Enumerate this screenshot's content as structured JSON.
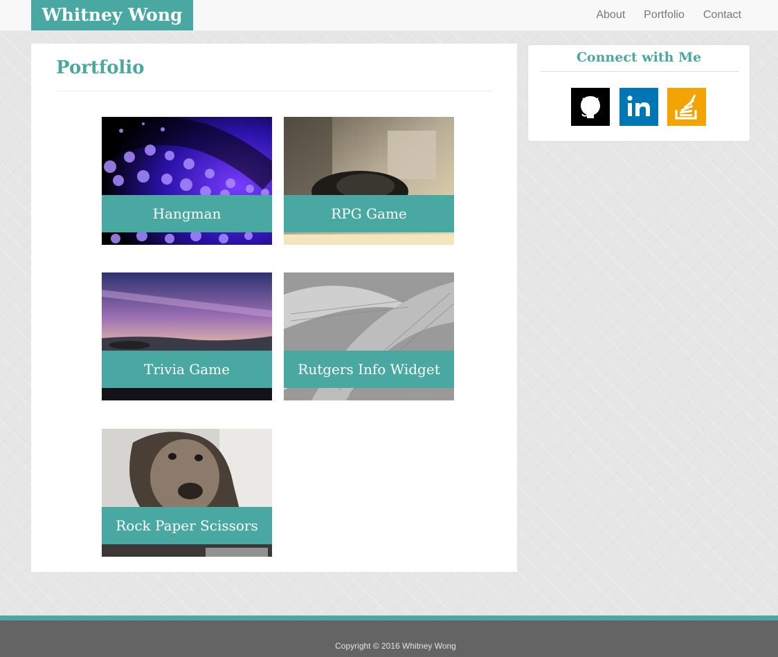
{
  "navbar": {
    "brand": "Whitney Wong",
    "links": [
      {
        "label": "About"
      },
      {
        "label": "Portfolio"
      },
      {
        "label": "Contact"
      }
    ]
  },
  "main": {
    "title": "Portfolio",
    "projects": [
      {
        "label": "Hangman",
        "image": "purple fiber optic lights"
      },
      {
        "label": "RPG Game",
        "image": "headphones on desk"
      },
      {
        "label": "Trivia Game",
        "image": "purple sunset over rocky shore"
      },
      {
        "label": "Rutgers Info Widget",
        "image": "grayscale leaves"
      },
      {
        "label": "Rock Paper Scissors",
        "image": "dog resting head"
      }
    ]
  },
  "sidebar": {
    "title": "Connect with Me",
    "social": [
      {
        "icon": "github-icon",
        "color": "#000000"
      },
      {
        "icon": "linkedin-icon",
        "color": "#0077b5"
      },
      {
        "icon": "stackoverflow-icon",
        "color": "#f4a402"
      }
    ]
  },
  "footer": {
    "copyright": "Copyright © 2016 Whitney Wong"
  },
  "colors": {
    "accent": "#49a8a2",
    "footer_bg": "#646464",
    "navbar_bg": "#f8f8f8"
  }
}
